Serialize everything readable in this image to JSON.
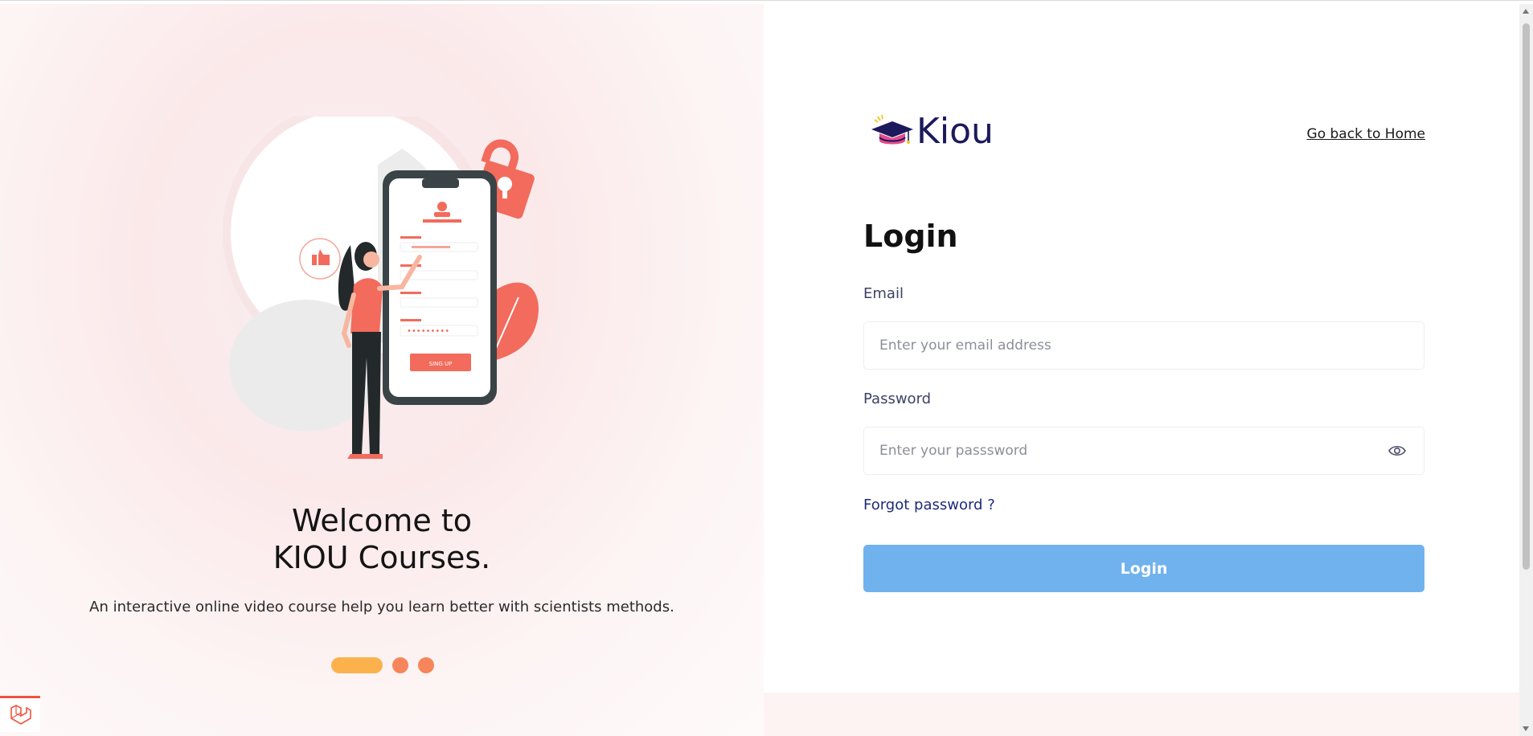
{
  "brand": {
    "name": "Kiou",
    "colors": {
      "primary": "#1c1a5c",
      "accent": "#f7855b",
      "highlight": "#fbb24c",
      "button": "#70b2ee"
    }
  },
  "header": {
    "home_link": "Go back to Home"
  },
  "hero": {
    "welcome_line1": "Welcome to",
    "welcome_line2": "KIOU Courses.",
    "tagline": "An interactive online video course help you learn better with scientists methods.",
    "carousel": {
      "slides": 3,
      "active_index": 0
    },
    "illustration_button_text": "SING UP"
  },
  "form": {
    "title": "Login",
    "email": {
      "label": "Email",
      "placeholder": "Enter your email address",
      "value": ""
    },
    "password": {
      "label": "Password",
      "placeholder": "Enter your passsword",
      "value": ""
    },
    "forgot_link": "Forgot password ?",
    "submit_label": "Login"
  },
  "icons": [
    "graduation-cap-icon",
    "eye-icon",
    "laravel-icon"
  ]
}
